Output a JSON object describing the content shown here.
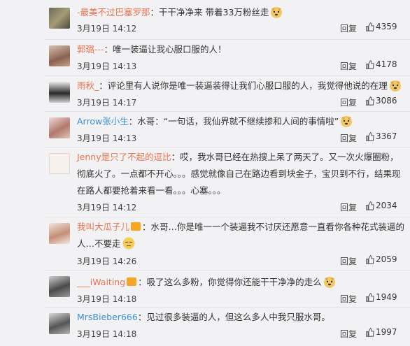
{
  "reply_label": "回复",
  "comments": [
    {
      "username": "-最美不过巴塞罗那",
      "text": "：干干净净来 带着33万粉丝走",
      "emoji": "doge-emoji",
      "date": "3月19日",
      "time": "14:12",
      "likes": "4359"
    },
    {
      "username": "郭璐---",
      "text": "：唯一装逼让我心服口服的人！",
      "emoji": "",
      "date": "3月19日",
      "time": "14:13",
      "likes": "4178"
    },
    {
      "username": "雨秋_",
      "text": "：评论里有人说你是唯一装逼装得让我们心服口服的人，我觉得他说的在理",
      "emoji": "doge-emoji",
      "date": "3月19日",
      "time": "14:17",
      "likes": "3086"
    },
    {
      "username": "Arrow张小生",
      "text": "：水哥：“一句话，我仙界就不继续掺和人间的事情啦”",
      "emoji": "doge-emoji",
      "date": "3月19日",
      "time": "14:13",
      "likes": "3367"
    },
    {
      "username": "Jenny是只了不起的逗比",
      "text": "：哎，我水哥已经在热搜上呆了两天了。又一次火爆圈粉，彻底火了。一点都不开心。。。感觉就像自己在路边看到块金子，宝贝到不行，结果现在路人都要抢着来看一看。。。心塞。。。",
      "emoji": "",
      "date": "3月19日",
      "time": "14:12",
      "likes": "2034"
    },
    {
      "username": "我叫大瓜子儿",
      "text": "：水哥…你是唯一一个装逼我不讨厌还愿意一直看你各种花式装逼的人…不要走",
      "emoji": "sad-emoji",
      "date": "3月19日",
      "time": "14:26",
      "likes": "2059"
    },
    {
      "username": "___iWaiting",
      "text": "：吸了这么多粉，你觉得你还能干干净净的走么",
      "emoji": "doge-emoji",
      "date": "3月19日",
      "time": "14:18",
      "likes": "1949"
    },
    {
      "username": "MrsBieber666",
      "text": "：见过很多装逼的人，但这么多人中我只服水哥。",
      "emoji": "",
      "date": "3月19日",
      "time": "14:18",
      "likes": "1997"
    }
  ],
  "colors": {
    "username_orange": "#eb7350",
    "username_blue": "#3e8ed8",
    "background": "#f2f2f5"
  }
}
